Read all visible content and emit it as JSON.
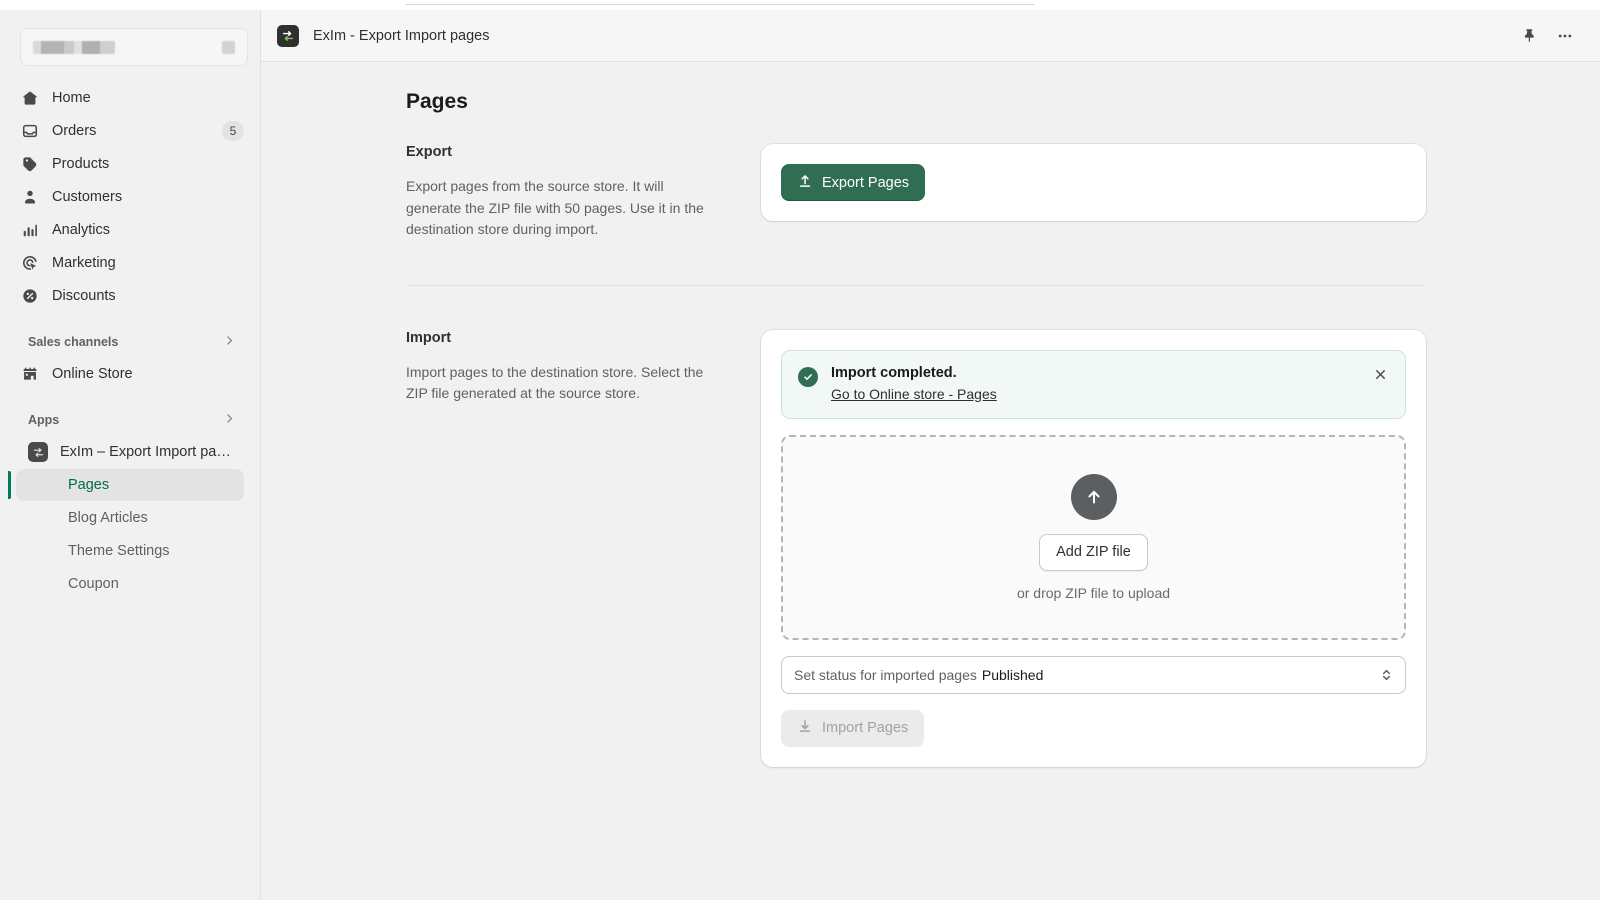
{
  "top_strip": {
    "present": true
  },
  "sidebar": {
    "store_switcher": {
      "name_redacted": "",
      "chevron_icon": "chevron-updown-icon"
    },
    "nav_items": [
      {
        "label": "Home",
        "icon": "home-icon",
        "badge": ""
      },
      {
        "label": "Orders",
        "icon": "orders-inbox-icon",
        "badge": "5"
      },
      {
        "label": "Products",
        "icon": "products-tag-icon",
        "badge": ""
      },
      {
        "label": "Customers",
        "icon": "customers-person-icon",
        "badge": ""
      },
      {
        "label": "Analytics",
        "icon": "analytics-bars-icon",
        "badge": ""
      },
      {
        "label": "Marketing",
        "icon": "marketing-target-icon",
        "badge": ""
      },
      {
        "label": "Discounts",
        "icon": "discounts-percent-icon",
        "badge": ""
      }
    ],
    "sections": [
      {
        "label": "Sales channels",
        "chevron": "›"
      },
      {
        "label": "Apps",
        "chevron": "›"
      }
    ],
    "sales_channels": [
      {
        "label": "Online Store",
        "icon": "storefront-icon"
      }
    ],
    "app": {
      "label": "ExIm – Export Import pa…",
      "icon": "exim-transfer-icon",
      "sub_items": [
        {
          "label": "Pages",
          "active": true
        },
        {
          "label": "Blog Articles",
          "active": false
        },
        {
          "label": "Theme Settings",
          "active": false
        },
        {
          "label": "Coupon",
          "active": false
        }
      ]
    }
  },
  "topbar": {
    "app_icon": "exim-transfer-icon",
    "title": "ExIm - Export Import pages",
    "pin_icon": "pin-icon",
    "more_icon": "ellipsis-icon"
  },
  "page": {
    "title": "Pages",
    "export": {
      "section_title": "Export",
      "description": "Export pages from the source store. It will generate the ZIP file with 50 pages. Use it in the destination store during import.",
      "button_label": "Export Pages",
      "button_icon": "export-up-arrow-icon"
    },
    "import": {
      "section_title": "Import",
      "description": "Import pages to the destination store. Select the ZIP file generated at the source store.",
      "banner": {
        "icon": "check-circle-icon",
        "title": "Import completed.",
        "link_label": "Go to Online store - Pages",
        "close_icon": "close-x-icon"
      },
      "dropzone": {
        "icon": "upload-arrow-icon",
        "button_label": "Add ZIP file",
        "hint": "or drop ZIP file to upload"
      },
      "status_select": {
        "label": "Set status for imported pages",
        "value": "Published",
        "chevron_icon": "chevron-updown-icon"
      },
      "submit": {
        "label": "Import Pages",
        "icon": "import-down-arrow-icon",
        "disabled": true
      }
    }
  },
  "colors": {
    "accent_green": "#2f6e52",
    "active_green": "#006d41",
    "banner_bg": "#f1f8f5",
    "sidebar_bg": "#f1f1f1",
    "canvas_bg": "#f1f1f1"
  }
}
